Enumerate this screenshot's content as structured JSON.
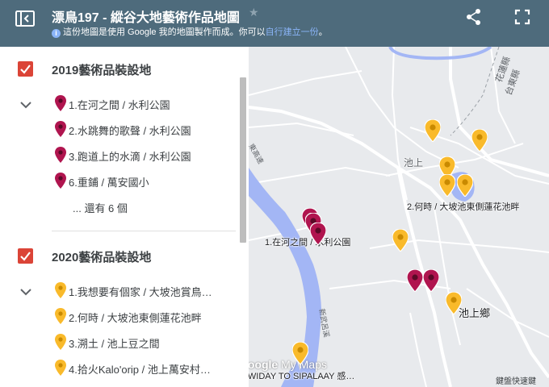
{
  "header": {
    "title": "漂鳥197 - 縱谷大地藝術作品地圖",
    "subtitle_prefix": "這份地圖是使用 Google 我的地圖製作而成。你可以",
    "subtitle_link": "自行建立一份",
    "subtitle_suffix": "。",
    "info_glyph": "i",
    "star_glyph": "★",
    "icons": [
      "sidebar-toggle-icon",
      "star-icon",
      "share-icon",
      "fullscreen-icon"
    ]
  },
  "colors": {
    "header_bg": "#4e6b7c",
    "checkbox": "#db4437",
    "pin_2019": "#b0154f",
    "pin_2020": "#f9ba2b",
    "river": "#a3b6f5",
    "link": "#8ab4f8"
  },
  "layers": [
    {
      "title": "2019藝術品裝設地",
      "items": [
        "1.在河之間 / 水利公園",
        "2.水跳舞的歌聲 / 水利公園",
        "3.跑道上的水滴 / 水利公園",
        "6.重鋪 / 萬安國小"
      ],
      "more": "... 還有 6 個"
    },
    {
      "title": "2020藝術品裝設地",
      "items": [
        "1.我想要有個家 / 大坡池賞鳥…",
        "2.何時 / 大坡池東側蓮花池畔",
        "3.溯土 / 池上豆之間",
        "4.拾火Kalo'orip / 池上萬安村…"
      ]
    }
  ],
  "map": {
    "labels": {
      "chishang": "池上",
      "chishang_township": "池上鄉",
      "label_hechi": "1.在河之間 / 水利公園",
      "label_heshi": "2.何時 / 大坡池東側蓮花池畔",
      "label_awiday": "AWIDAY TO SIPALAAY 感…",
      "hualien_county": "花蓮縣",
      "taitung_county": "台東縣",
      "road_left": "東高速",
      "road_river": "新武呂溪",
      "shortcuts": "鍵盤快速鍵"
    },
    "logo_google": "Google",
    "logo_mymaps": "My Maps"
  }
}
